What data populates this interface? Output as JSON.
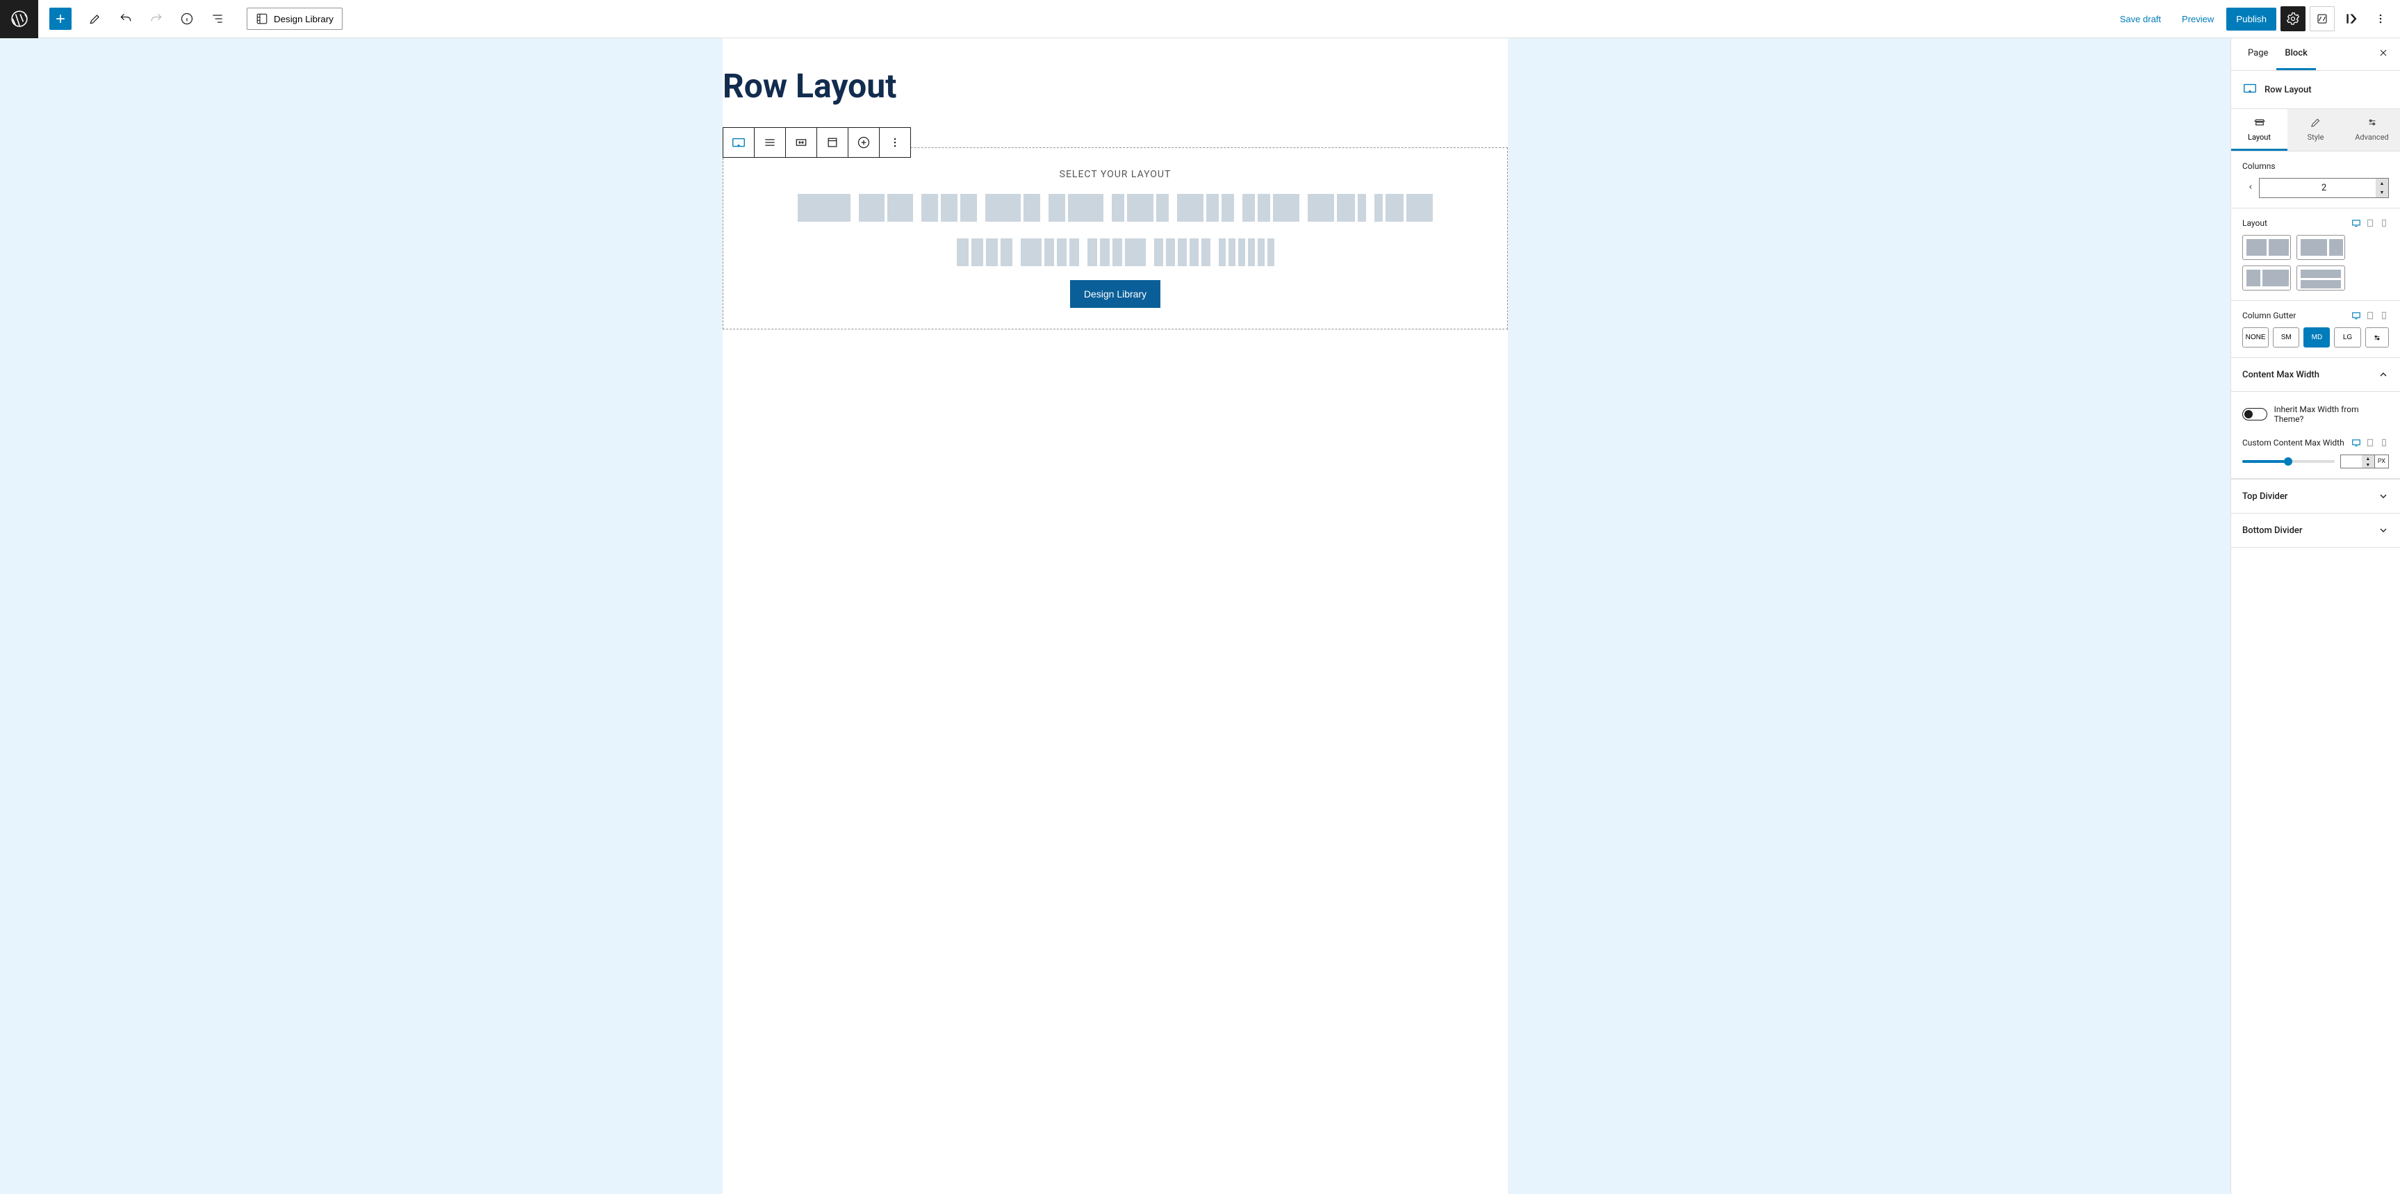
{
  "toolbar": {
    "design_library": "Design Library",
    "save_draft": "Save draft",
    "preview": "Preview",
    "publish": "Publish"
  },
  "canvas": {
    "page_title": "Row Layout",
    "placeholder_title": "SELECT YOUR LAYOUT",
    "placeholder_button": "Design Library"
  },
  "sidebar": {
    "tabs": {
      "page": "Page",
      "block": "Block"
    },
    "block_name": "Row Layout",
    "settings_tabs": {
      "layout": "Layout",
      "style": "Style",
      "advanced": "Advanced"
    },
    "columns": {
      "label": "Columns",
      "value": "2"
    },
    "layout_label": "Layout",
    "gutter": {
      "label": "Column Gutter",
      "options": {
        "none": "NONE",
        "sm": "SM",
        "md": "MD",
        "lg": "LG"
      },
      "selected": "MD"
    },
    "content_max_width": {
      "title": "Content Max Width",
      "inherit_label": "Inherit Max Width from Theme?",
      "custom_label": "Custom Content Max Width",
      "unit": "PX"
    },
    "top_divider": "Top Divider",
    "bottom_divider": "Bottom Divider"
  }
}
